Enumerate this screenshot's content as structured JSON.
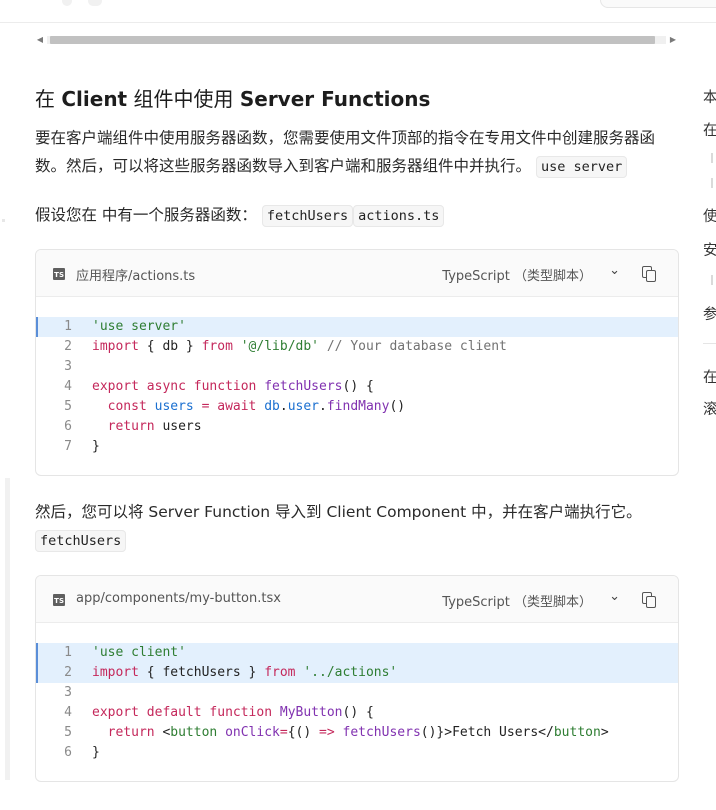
{
  "section_title": {
    "pre": "在 ",
    "b1": "Client",
    "mid": " 组件中使用 ",
    "b2": "Server Functions"
  },
  "para1": {
    "text": "要在客户端组件中使用服务器函数，您需要使用文件顶部的指令在专用文件中创建服务器函数。然后，可以将这些服务器函数导入到客户端和服务器组件中并执行。",
    "code": "use server"
  },
  "para2": {
    "text": "假设您在 中有一个服务器函数：",
    "code1": "fetchUsers",
    "code2": "actions.ts"
  },
  "para3": {
    "text": "然后，您可以将 Server Function 导入到 Client Component 中，并在客户端执行它。",
    "code": "fetchUsers"
  },
  "code_blocks": [
    {
      "filename": "应用程序/actions.ts",
      "language": "TypeScript （类型脚本）",
      "icon": "ts-file-icon",
      "line_numbers": [
        "1",
        "2",
        "3",
        "4",
        "5",
        "6",
        "7"
      ],
      "lines": [
        [
          {
            "t": "s",
            "v": "'use server'"
          }
        ],
        [
          {
            "t": "k",
            "v": "import"
          },
          {
            "t": "p",
            "v": " { db } "
          },
          {
            "t": "k",
            "v": "from"
          },
          {
            "t": "p",
            "v": " "
          },
          {
            "t": "s",
            "v": "'@/lib/db'"
          },
          {
            "t": "p",
            "v": " "
          },
          {
            "t": "c",
            "v": "// Your database client"
          }
        ],
        [],
        [
          {
            "t": "k",
            "v": "export"
          },
          {
            "t": "p",
            "v": " "
          },
          {
            "t": "k",
            "v": "async"
          },
          {
            "t": "p",
            "v": " "
          },
          {
            "t": "k",
            "v": "function"
          },
          {
            "t": "p",
            "v": " "
          },
          {
            "t": "f",
            "v": "fetchUsers"
          },
          {
            "t": "p",
            "v": "() {"
          }
        ],
        [
          {
            "t": "p",
            "v": "  "
          },
          {
            "t": "k",
            "v": "const"
          },
          {
            "t": "p",
            "v": " "
          },
          {
            "t": "v",
            "v": "users"
          },
          {
            "t": "p",
            "v": " "
          },
          {
            "t": "k",
            "v": "="
          },
          {
            "t": "p",
            "v": " "
          },
          {
            "t": "k",
            "v": "await"
          },
          {
            "t": "p",
            "v": " "
          },
          {
            "t": "v",
            "v": "db"
          },
          {
            "t": "p",
            "v": "."
          },
          {
            "t": "v",
            "v": "user"
          },
          {
            "t": "p",
            "v": "."
          },
          {
            "t": "f",
            "v": "findMany"
          },
          {
            "t": "p",
            "v": "()"
          }
        ],
        [
          {
            "t": "p",
            "v": "  "
          },
          {
            "t": "k",
            "v": "return"
          },
          {
            "t": "p",
            "v": " users"
          }
        ],
        [
          {
            "t": "p",
            "v": "}"
          }
        ]
      ],
      "highlighted": [
        0
      ]
    },
    {
      "filename": "app/components/my-button.tsx",
      "language": "TypeScript （类型脚本）",
      "icon": "ts-file-icon",
      "line_numbers": [
        "1",
        "2",
        "3",
        "4",
        "5",
        "6"
      ],
      "lines": [
        [
          {
            "t": "s",
            "v": "'use client'"
          }
        ],
        [
          {
            "t": "k",
            "v": "import"
          },
          {
            "t": "p",
            "v": " { fetchUsers } "
          },
          {
            "t": "k",
            "v": "from"
          },
          {
            "t": "p",
            "v": " "
          },
          {
            "t": "s",
            "v": "'../actions'"
          }
        ],
        [],
        [
          {
            "t": "k",
            "v": "export"
          },
          {
            "t": "p",
            "v": " "
          },
          {
            "t": "k",
            "v": "default"
          },
          {
            "t": "p",
            "v": " "
          },
          {
            "t": "k",
            "v": "function"
          },
          {
            "t": "p",
            "v": " "
          },
          {
            "t": "f",
            "v": "MyButton"
          },
          {
            "t": "p",
            "v": "() {"
          }
        ],
        [
          {
            "t": "p",
            "v": "  "
          },
          {
            "t": "k",
            "v": "return"
          },
          {
            "t": "p",
            "v": " <"
          },
          {
            "t": "s",
            "v": "button"
          },
          {
            "t": "p",
            "v": " "
          },
          {
            "t": "f",
            "v": "onClick"
          },
          {
            "t": "k",
            "v": "="
          },
          {
            "t": "p",
            "v": "{() "
          },
          {
            "t": "k",
            "v": "=>"
          },
          {
            "t": "p",
            "v": " "
          },
          {
            "t": "f",
            "v": "fetchUsers"
          },
          {
            "t": "p",
            "v": "()}>Fetch Users</"
          },
          {
            "t": "s",
            "v": "button"
          },
          {
            "t": "p",
            "v": ">"
          }
        ],
        [
          {
            "t": "p",
            "v": "}"
          }
        ]
      ],
      "highlighted": [
        0,
        1
      ]
    }
  ],
  "toc": [
    {
      "label": "本"
    },
    {
      "label": "在"
    },
    {
      "label": "使"
    },
    {
      "label": "安"
    },
    {
      "label": "参"
    },
    {
      "label": "在"
    },
    {
      "label": "滚"
    }
  ],
  "colors": {
    "keyword": "#c4285b",
    "string": "#2e7d32",
    "function": "#8132b0",
    "variable": "#1a6fd0",
    "comment": "#727272",
    "highlight": "#e3f0fd"
  }
}
